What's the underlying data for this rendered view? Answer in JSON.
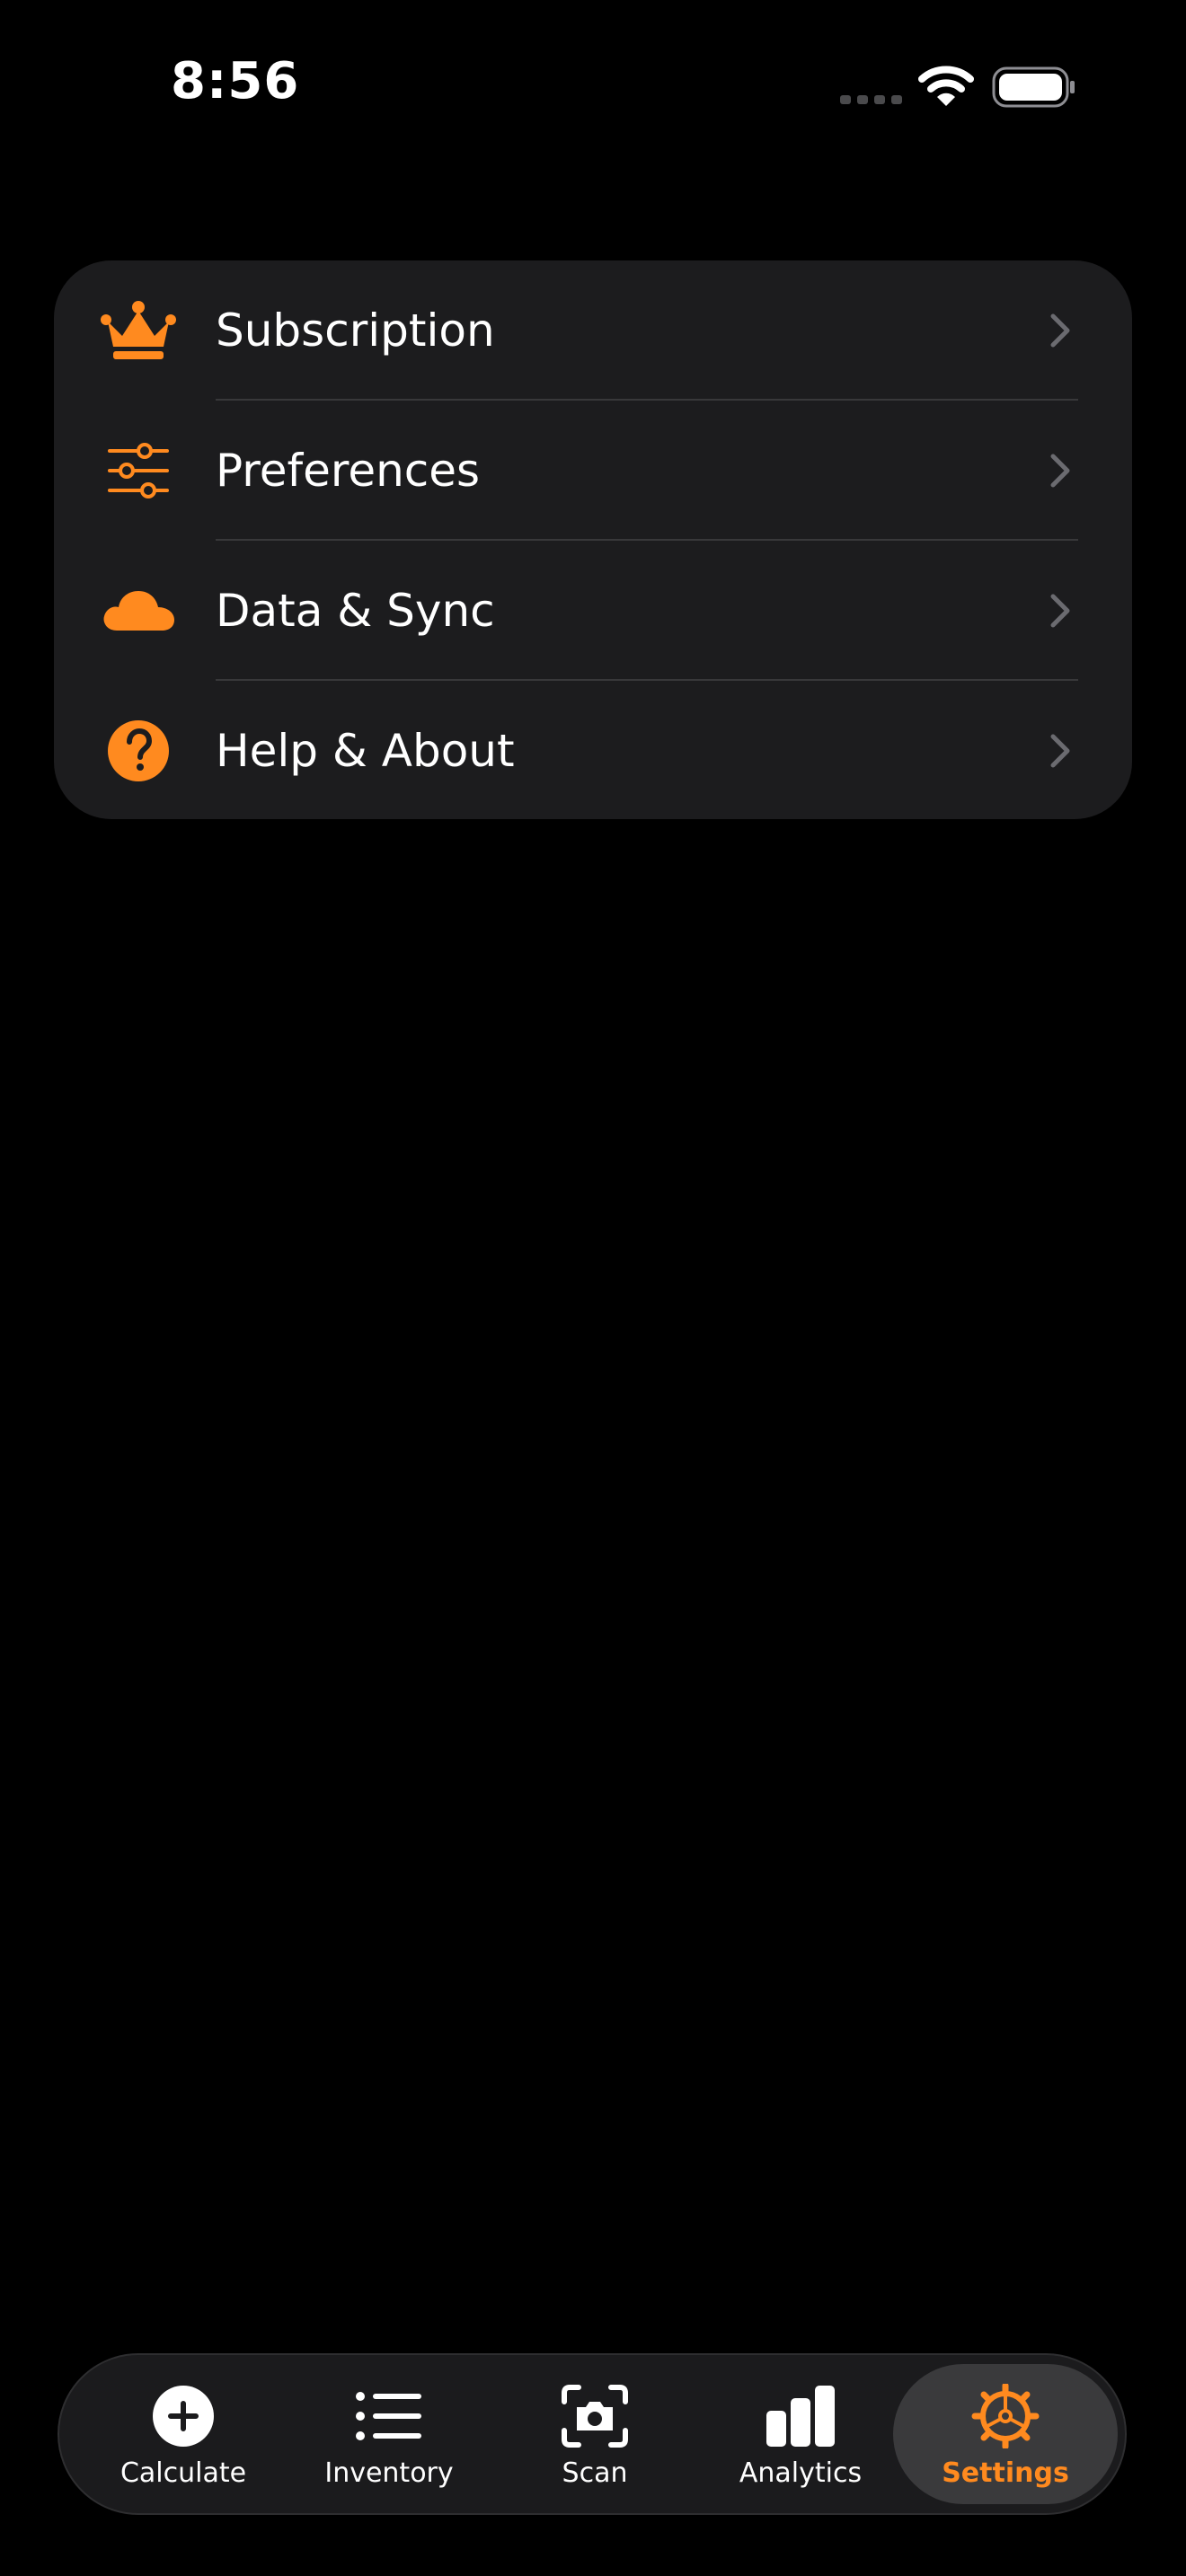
{
  "status_bar": {
    "time": "8:56"
  },
  "settings_menu": {
    "items": [
      {
        "label": "Subscription",
        "icon": "crown-icon"
      },
      {
        "label": "Preferences",
        "icon": "sliders-icon"
      },
      {
        "label": "Data & Sync",
        "icon": "cloud-icon"
      },
      {
        "label": "Help & About",
        "icon": "question-circle-icon"
      }
    ]
  },
  "tab_bar": {
    "tabs": [
      {
        "label": "Calculate",
        "icon": "plus-circle-icon"
      },
      {
        "label": "Inventory",
        "icon": "list-icon"
      },
      {
        "label": "Scan",
        "icon": "camera-scan-icon"
      },
      {
        "label": "Analytics",
        "icon": "bar-chart-icon"
      },
      {
        "label": "Settings",
        "icon": "gear-icon",
        "active": true
      }
    ]
  },
  "colors": {
    "accent": "#ff8a1f",
    "background": "#000000",
    "card": "#1c1c1e",
    "divider": "#38383a",
    "chevron": "#6b6b70"
  }
}
